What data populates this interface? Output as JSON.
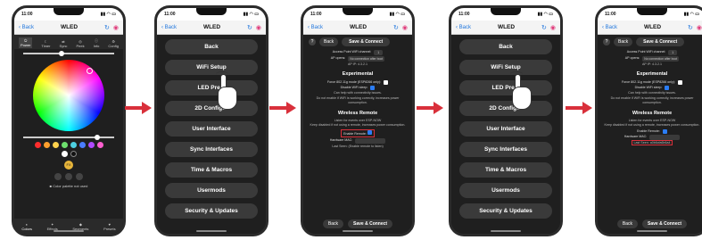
{
  "status_time": "11:00",
  "nav": {
    "back": "Back",
    "title": "WLED"
  },
  "phone1": {
    "tabs_top": [
      "Power",
      "Timer",
      "Sync",
      "Peek",
      "Info",
      "Config"
    ],
    "palette_note": "Color palette not used",
    "fx_label": "FX",
    "tabs_bottom": [
      "Colors",
      "Effects",
      "Segments",
      "Presets"
    ],
    "swatch_colors": [
      "#ff2d2d",
      "#ff9f2d",
      "#ffd24d",
      "#6ee06e",
      "#4dd0e1",
      "#4a7dff",
      "#b04aff",
      "#ff5fd0",
      "#ffffff",
      "#111111"
    ]
  },
  "menu": {
    "items": [
      "Back",
      "WiFi Setup",
      "LED Preferences",
      "2D Configuration",
      "User Interface",
      "Sync Interfaces",
      "Time & Macros",
      "Usermods",
      "Security & Updates"
    ],
    "visible_labels": [
      "Back",
      "WiFi Setup",
      "LED Prefe",
      "2D Configur",
      "User Interface",
      "Sync Interfaces",
      "Time & Macros",
      "Usermods",
      "Security & Updates"
    ]
  },
  "settings": {
    "toolbar_q": "?",
    "back": "Back",
    "save": "Save & Connect",
    "ap_channel_label": "Access Point WiFi channel:",
    "ap_channel_value": "1",
    "ap_opens_label": "AP opens:",
    "ap_opens_value": "No connection after boot",
    "ap_ip": "AP IP: 4.3.2.1",
    "experimental": "Experimental",
    "force_label": "Force 802.11g mode (ESP8266 only):",
    "disable_sleep_label": "Disable WiFi sleep:",
    "help_note": "Can help with connectivity issues.",
    "warning": "Do not enable if WiFi is working correctly, increases power consumption.",
    "wireless_remote": "Wireless Remote",
    "listen_note": "Listen for events over ESP-NOW",
    "keep_note": "Keep disabled if not using a remote, increases power consumption.",
    "enable_remote": "Enable Remote:",
    "hardware_mac": "Hardware MAC:",
    "last_seen_a": "Last Seen: (Enable remote to listen)",
    "last_seen_b": "Last Seen: a0b6cfa6b6a4"
  }
}
